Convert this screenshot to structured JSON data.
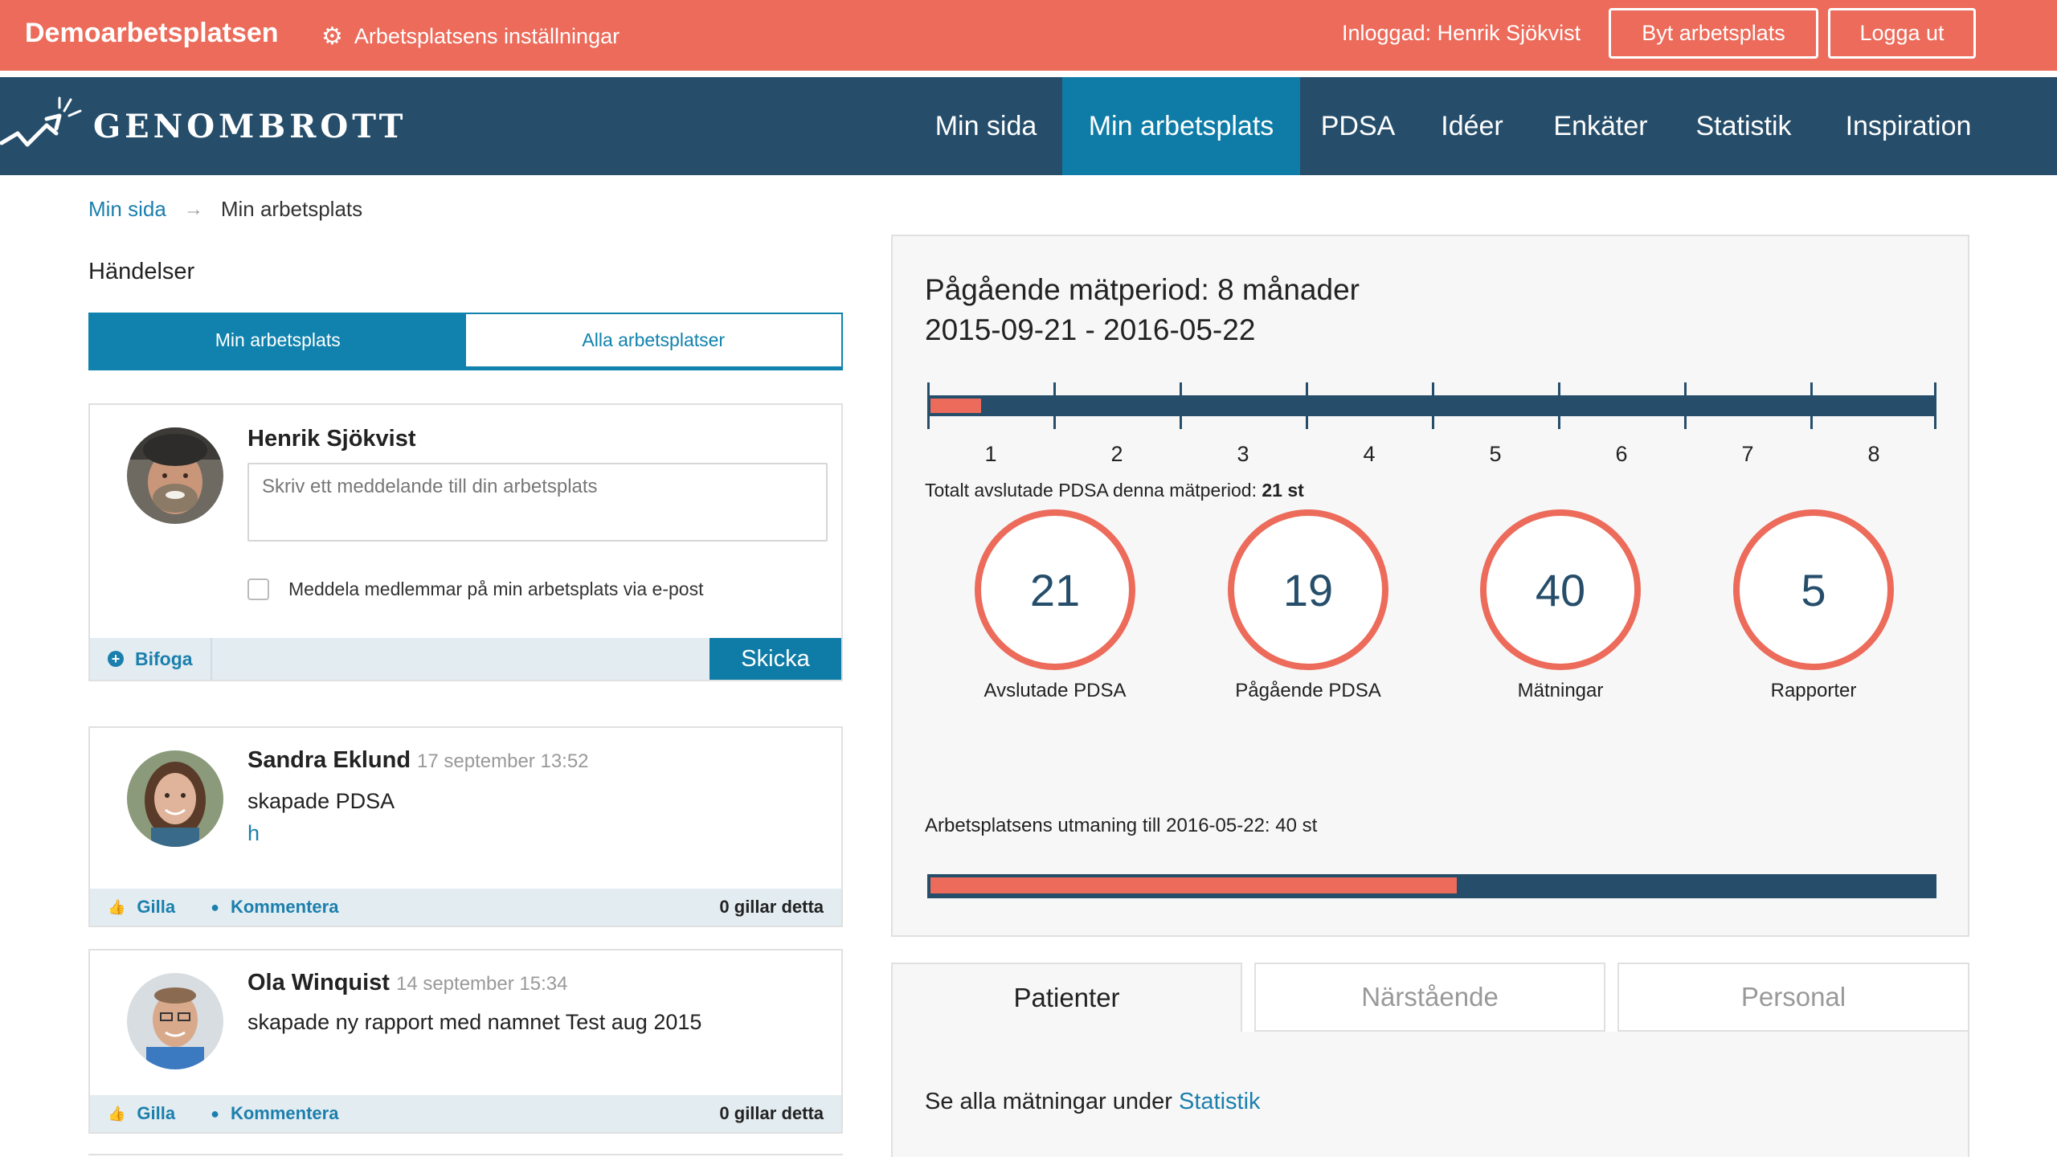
{
  "topbar": {
    "brand": "Demoarbetsplatsen",
    "settings_label": "Arbetsplatsens inställningar",
    "logged_in": "Inloggad: Henrik Sjökvist",
    "switch_button": "Byt arbetsplats",
    "logout_button": "Logga ut",
    "color": "#ec6b5a"
  },
  "nav": {
    "logo_text": "GENOMBROTT",
    "items": [
      {
        "label": "Min sida",
        "active": false
      },
      {
        "label": "Min arbetsplats",
        "active": true
      },
      {
        "label": "PDSA",
        "active": false
      },
      {
        "label": "Idéer",
        "active": false
      },
      {
        "label": "Enkäter",
        "active": false
      },
      {
        "label": "Statistik",
        "active": false
      },
      {
        "label": "Inspiration",
        "active": false
      }
    ],
    "color": "#264e6b",
    "active_color": "#0f7ca7"
  },
  "breadcrumb": {
    "home": "Min sida",
    "separator": "→",
    "current": "Min arbetsplats"
  },
  "events": {
    "title": "Händelser",
    "toggle": [
      "Min arbetsplats",
      "Alla arbetsplatser"
    ],
    "toggle_selected": "Min arbetsplats"
  },
  "composer": {
    "author": "Henrik Sjökvist",
    "placeholder": "Skriv ett meddelande till din arbetsplats",
    "notify_label": "Meddela medlemmar på min arbetsplats via e-post",
    "attach_label": "Bifoga",
    "send_label": "Skicka"
  },
  "feed": [
    {
      "author": "Sandra Eklund",
      "timestamp": "17 september 13:52",
      "text": "skapade PDSA",
      "link": "h",
      "like_label": "Gilla",
      "comment_label": "Kommentera",
      "likes": "0 gillar detta"
    },
    {
      "author": "Ola Winquist",
      "timestamp": "14 september 15:34",
      "text": "skapade ny rapport med namnet Test aug 2015",
      "link": "",
      "like_label": "Gilla",
      "comment_label": "Kommentera",
      "likes": "0 gillar detta"
    }
  ],
  "period": {
    "title": "Pågående mätperiod: 8 månader",
    "range": "2015-09-21 - 2016-05-22",
    "months": [
      "1",
      "2",
      "3",
      "4",
      "5",
      "6",
      "7",
      "8"
    ],
    "progress_fraction": 0.05,
    "total_prefix": "Totalt avslutade PDSA denna mätperiod: ",
    "total_value": "21 st"
  },
  "stats": [
    {
      "value": "21",
      "label": "Avslutade PDSA"
    },
    {
      "value": "19",
      "label": "Pågående PDSA"
    },
    {
      "value": "40",
      "label": "Mätningar"
    },
    {
      "value": "5",
      "label": "Rapporter"
    }
  ],
  "challenge": {
    "label": "Arbetsplatsens utmaning till 2016-05-22: 40 st",
    "progress_fraction": 0.525
  },
  "tabs": {
    "items": [
      "Patienter",
      "Närstående",
      "Personal"
    ],
    "selected": "Patienter"
  },
  "tab_content": {
    "text": "Se alla mätningar under ",
    "link": "Statistik"
  }
}
